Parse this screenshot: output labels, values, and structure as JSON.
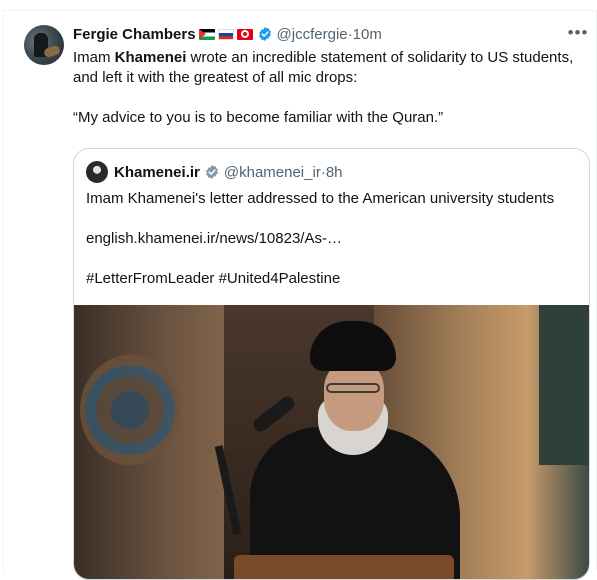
{
  "tweet": {
    "author_name": "Fergie Chambers",
    "author_handle": "@jccfergie",
    "time": "10m",
    "flags": [
      "palestine-flag-icon",
      "russia-flag-icon",
      "tunisia-flag-icon"
    ],
    "text_lines": [
      [
        "Imam ",
        "Khamenei",
        " wrote an incredible statement of solidarity to US students, and left it with the greatest of all mic drops:"
      ],
      "“My advice to you is to become familiar with the Quran.”"
    ],
    "para1_pre": "Imam ",
    "para1_bold": "Khamenei",
    "para1_post": " wrote an incredible statement of solidarity to US students, and left it with the greatest of all mic drops:",
    "para2": "“My advice to you is to become familiar with the Quran.”",
    "more_label": "•••"
  },
  "quoted": {
    "author_name": "Khamenei.ir",
    "author_handle": "@khamenei_ir",
    "time": "8h",
    "line1": "Imam Khamenei's letter addressed to the American university students",
    "line2": "english.khamenei.ir/news/10823/As-…",
    "line3": "#LetterFromLeader #United4Palestine"
  },
  "colors": {
    "verified": "#1d9bf0",
    "secondary_text": "#536471",
    "border": "#cfd9de"
  },
  "separator": " · "
}
